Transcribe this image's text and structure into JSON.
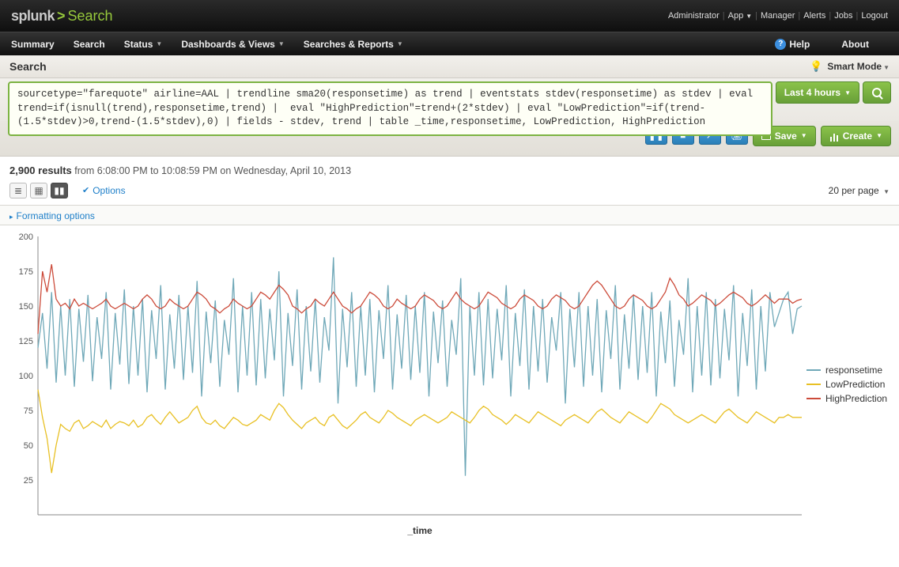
{
  "brand": {
    "name": "splunk",
    "separator": ">",
    "section": "Search"
  },
  "top_links": {
    "admin": "Administrator",
    "app": "App",
    "manager": "Manager",
    "alerts": "Alerts",
    "jobs": "Jobs",
    "logout": "Logout"
  },
  "menu": {
    "summary": "Summary",
    "search": "Search",
    "status": "Status",
    "dashboards": "Dashboards & Views",
    "reports": "Searches & Reports",
    "help": "Help",
    "about": "About"
  },
  "search_header": {
    "title": "Search",
    "smart_mode": "Smart Mode"
  },
  "query_text": "sourcetype=\"farequote\" airline=AAL | trendline sma20(responsetime) as trend | eventstats stdev(responsetime) as stdev | eval trend=if(isnull(trend),responsetime,trend) |  eval \"HighPrediction\"=trend+(2*stdev) | eval \"LowPrediction\"=if(trend-(1.5*stdev)>0,trend-(1.5*stdev),0) | fields - stdev, trend | table _time,responsetime, LowPrediction, HighPrediction",
  "time_picker": "Last 4 hours",
  "action_buttons": {
    "save": "Save",
    "create": "Create"
  },
  "results_line": {
    "count": "2,900 results",
    "range": "from 6:08:00 PM to 10:08:59 PM on Wednesday, April 10, 2013"
  },
  "options_label": "Options",
  "per_page": "20 per page",
  "formatting": "Formatting options",
  "legend": {
    "s1": "responsetime",
    "s2": "LowPrediction",
    "s3": "HighPrediction"
  },
  "colors": {
    "responsetime": "#6fa8b8",
    "low": "#e8c024",
    "high": "#cc4b3a"
  },
  "chart_data": {
    "type": "line",
    "xlabel": "_time",
    "ylabel": "",
    "ylim": [
      0,
      200
    ],
    "yticks": [
      25,
      50,
      75,
      100,
      125,
      150,
      175,
      200
    ],
    "series": [
      {
        "name": "responsetime",
        "color": "#6fa8b8",
        "values": [
          120,
          145,
          105,
          160,
          95,
          150,
          100,
          155,
          92,
          148,
          110,
          158,
          96,
          142,
          112,
          160,
          90,
          145,
          108,
          162,
          94,
          150,
          100,
          155,
          88,
          147,
          112,
          165,
          90,
          144,
          105,
          158,
          97,
          150,
          102,
          168,
          85,
          146,
          109,
          154,
          92,
          140,
          115,
          170,
          88,
          150,
          100,
          160,
          93,
          155,
          98,
          148,
          111,
          175,
          85,
          145,
          107,
          162,
          90,
          150,
          103,
          155,
          95,
          142,
          118,
          185,
          80,
          148,
          106,
          160,
          92,
          150,
          100,
          155,
          88,
          147,
          112,
          165,
          90,
          144,
          105,
          158,
          97,
          150,
          102,
          160,
          85,
          146,
          109,
          154,
          92,
          140,
          115,
          170,
          28,
          150,
          100,
          160,
          93,
          155,
          98,
          148,
          111,
          165,
          85,
          145,
          107,
          162,
          90,
          150,
          103,
          155,
          95,
          142,
          118,
          160,
          80,
          148,
          106,
          160,
          92,
          150,
          100,
          155,
          88,
          147,
          112,
          165,
          90,
          144,
          105,
          158,
          97,
          150,
          102,
          160,
          85,
          146,
          109,
          154,
          92,
          140,
          115,
          170,
          88,
          150,
          100,
          160,
          93,
          155,
          98,
          148,
          111,
          165,
          85,
          145,
          107,
          162,
          90,
          150,
          103,
          160,
          135,
          145,
          155,
          160,
          130,
          148,
          150
        ]
      },
      {
        "name": "LowPrediction",
        "color": "#e8c024",
        "values": [
          90,
          70,
          55,
          30,
          50,
          65,
          62,
          60,
          66,
          68,
          62,
          64,
          67,
          65,
          63,
          68,
          62,
          65,
          67,
          66,
          64,
          68,
          63,
          65,
          70,
          72,
          68,
          65,
          70,
          74,
          70,
          66,
          68,
          70,
          75,
          78,
          70,
          66,
          65,
          68,
          64,
          62,
          66,
          70,
          68,
          65,
          64,
          66,
          68,
          72,
          70,
          68,
          75,
          80,
          77,
          72,
          68,
          65,
          62,
          66,
          68,
          70,
          66,
          64,
          70,
          72,
          68,
          64,
          62,
          65,
          68,
          72,
          74,
          70,
          68,
          66,
          70,
          75,
          73,
          70,
          68,
          66,
          64,
          68,
          70,
          72,
          70,
          68,
          66,
          68,
          70,
          74,
          72,
          70,
          68,
          66,
          70,
          75,
          78,
          76,
          72,
          70,
          68,
          65,
          68,
          72,
          70,
          68,
          66,
          70,
          74,
          72,
          70,
          68,
          66,
          64,
          68,
          70,
          72,
          70,
          68,
          66,
          70,
          74,
          76,
          73,
          70,
          68,
          66,
          70,
          74,
          72,
          70,
          68,
          66,
          70,
          75,
          80,
          78,
          76,
          72,
          70,
          68,
          66,
          68,
          70,
          72,
          70,
          68,
          66,
          70,
          74,
          76,
          73,
          70,
          68,
          66,
          70,
          74,
          72,
          70,
          68,
          66,
          70,
          70,
          72,
          70,
          70,
          70
        ]
      },
      {
        "name": "HighPrediction",
        "color": "#cc4b3a",
        "values": [
          130,
          175,
          160,
          180,
          155,
          150,
          152,
          148,
          155,
          150,
          152,
          150,
          148,
          150,
          152,
          155,
          150,
          148,
          150,
          152,
          150,
          148,
          150,
          155,
          158,
          155,
          150,
          148,
          150,
          155,
          152,
          150,
          148,
          150,
          155,
          160,
          158,
          155,
          150,
          148,
          145,
          148,
          150,
          155,
          152,
          150,
          148,
          150,
          155,
          160,
          158,
          155,
          160,
          165,
          162,
          158,
          150,
          148,
          145,
          148,
          150,
          155,
          152,
          150,
          155,
          160,
          155,
          150,
          148,
          145,
          148,
          150,
          155,
          160,
          158,
          155,
          150,
          148,
          150,
          155,
          152,
          150,
          148,
          150,
          155,
          158,
          156,
          154,
          150,
          148,
          150,
          155,
          160,
          155,
          152,
          150,
          148,
          150,
          155,
          160,
          158,
          156,
          152,
          150,
          148,
          150,
          155,
          158,
          156,
          154,
          150,
          148,
          150,
          155,
          158,
          156,
          154,
          150,
          148,
          150,
          155,
          160,
          165,
          168,
          165,
          160,
          155,
          150,
          148,
          150,
          155,
          158,
          156,
          154,
          150,
          148,
          150,
          155,
          160,
          170,
          165,
          158,
          155,
          150,
          152,
          155,
          158,
          156,
          154,
          150,
          152,
          155,
          158,
          160,
          158,
          156,
          152,
          150,
          152,
          155,
          158,
          155,
          152,
          155,
          155,
          155,
          152,
          154,
          155
        ]
      }
    ]
  }
}
